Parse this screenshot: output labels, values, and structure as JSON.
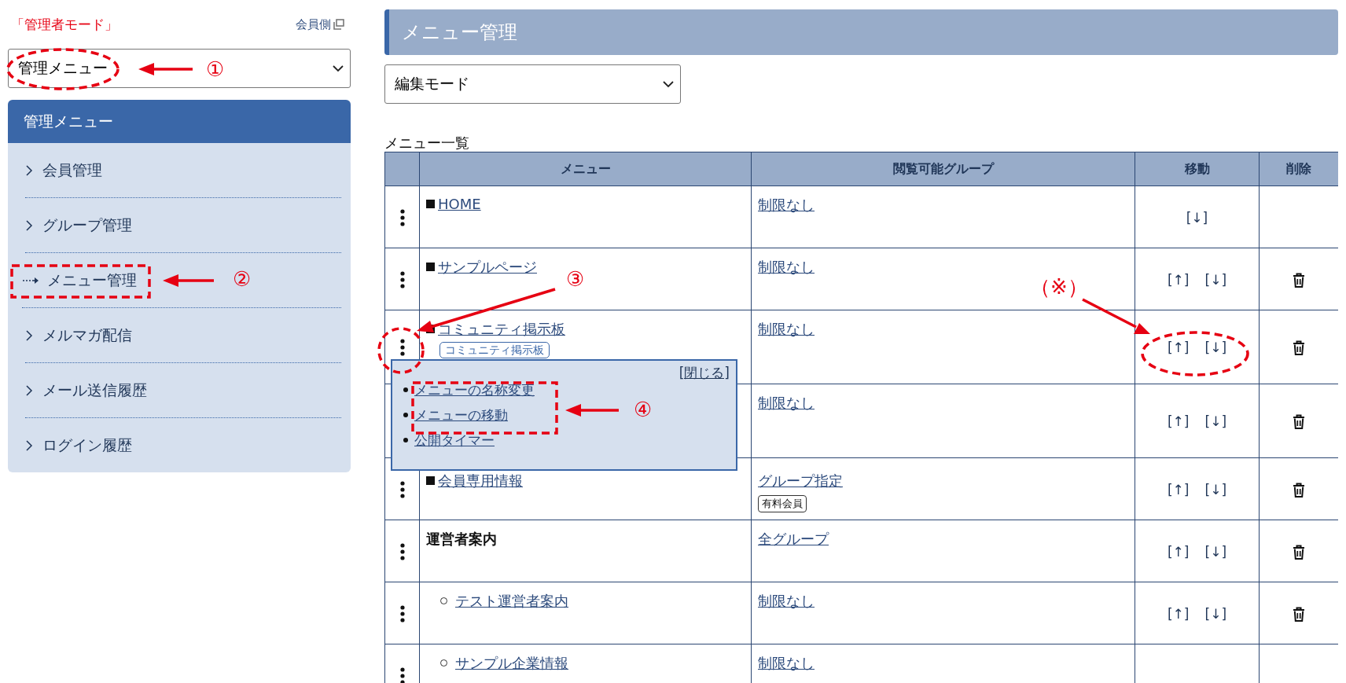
{
  "sidebar": {
    "mode_label": "「管理者モード」",
    "member_link": "会員側",
    "menu_select": {
      "value": "管理メニュー"
    },
    "panel_title": "管理メニュー",
    "items": [
      {
        "label": "会員管理",
        "selected": false
      },
      {
        "label": "グループ管理",
        "selected": false
      },
      {
        "label": "メニュー管理",
        "selected": true
      },
      {
        "label": "メルマガ配信",
        "selected": false
      },
      {
        "label": "メール送信履歴",
        "selected": false
      },
      {
        "label": "ログイン履歴",
        "selected": false
      }
    ]
  },
  "main": {
    "title": "メニュー管理",
    "mode_select": {
      "value": "編集モード"
    },
    "list_title": "メニュー一覧",
    "table": {
      "columns": [
        "メニュー",
        "閲覧可能グループ",
        "移動",
        "削除"
      ],
      "rows": [
        {
          "kind": "page",
          "menu": "HOME",
          "group": "制限なし",
          "move": [
            "[↓]"
          ],
          "deletable": false
        },
        {
          "kind": "page",
          "menu": "サンプルページ",
          "group": "制限なし",
          "move": [
            "[↑]",
            "[↓]"
          ],
          "deletable": true
        },
        {
          "kind": "page",
          "menu": "コミュニティ掲示板",
          "tag": "コミュニティ掲示板",
          "group": "制限なし",
          "move": [
            "[↑]",
            "[↓]"
          ],
          "deletable": true
        },
        {
          "group": "制限なし",
          "move": [
            "[↑]",
            "[↓]"
          ],
          "deletable": true
        },
        {
          "kind": "page",
          "menu": "会員専用情報",
          "group": "グループ指定",
          "group_tag": "有料会員",
          "move": [
            "[↑]",
            "[↓]"
          ],
          "deletable": true
        },
        {
          "kind": "heading",
          "menu": "運営者案内",
          "group": "全グループ",
          "move": [
            "[↑]",
            "[↓]"
          ],
          "deletable": true
        },
        {
          "kind": "child",
          "menu": "テスト運営者案内",
          "group": "制限なし",
          "move": [
            "[↑]",
            "[↓]"
          ],
          "deletable": true
        },
        {
          "kind": "child",
          "menu": "サンプル企業情報",
          "group": "制限なし"
        }
      ]
    },
    "popup": {
      "close": "[閉じる]",
      "items": [
        "メニューの名称変更",
        "メニューの移動",
        "公開タイマー"
      ]
    }
  },
  "annotations": [
    "①",
    "②",
    "③",
    "④",
    "（※）"
  ]
}
